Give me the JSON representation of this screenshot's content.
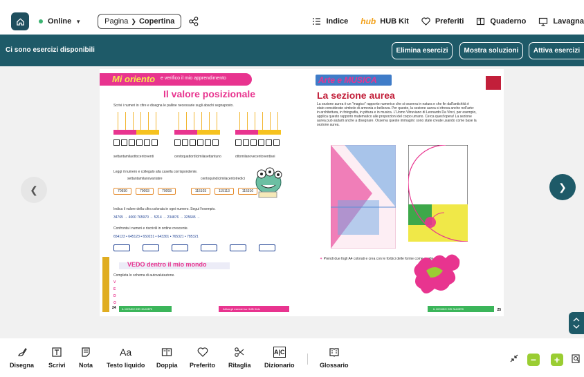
{
  "topbar": {
    "status_label": "Online",
    "breadcrumb": {
      "section": "Pagina",
      "page": "Copertina"
    },
    "nav": [
      {
        "label": "Indice",
        "icon": "list-icon"
      },
      {
        "label": "HUB Kit",
        "icon": "hub-kit-logo",
        "logo_text": "hub"
      },
      {
        "label": "Preferiti",
        "icon": "heart-icon"
      },
      {
        "label": "Quaderno",
        "icon": "notebook-icon"
      },
      {
        "label": "Lavagna",
        "icon": "whiteboard-icon"
      }
    ]
  },
  "band": {
    "title": "Ci sono esercizi disponibili",
    "buttons": [
      "Elimina esercizi",
      "Mostra soluzioni",
      "Attiva esercizi"
    ]
  },
  "reader": {
    "left_page": {
      "header": "Mi oriento",
      "header_sub": "e verifico il mio apprendimento",
      "title": "Il valore posizionale",
      "ex1": "Scrivi i numeri in cifre e disegna le palline necessarie sugli abachi segnaposto.",
      "abaco_labels": [
        "settantamilaottocentoventi",
        "centoquattordicimilasettantuno",
        "ottomilanovecentoventisei"
      ],
      "ex2": "Leggi il numero e collegalo alla casella corrispondente.",
      "ex2_words": [
        "settantamilanovantatre",
        "centoquindicimilacentotredici"
      ],
      "ex2_numbers": [
        "70930",
        "79093",
        "70093",
        "115103",
        "115113",
        "115310"
      ],
      "ex3": "Indica il valore della cifra colorata in ogni numero. Segui l'esempio.",
      "ex3_line": "34765 → 4000   765970 →        5214 →        234876 →        325645 →",
      "ex4": "Confronta i numeri e riscrivili in ordine crescente.",
      "ex4_line": "654123 • 645123 • 650231 • 643301 • 765321 • 785321",
      "vedo_title": "VEDO dentro il mio mondo",
      "vedo_sub": "Completa lo schema di autovalutazione.",
      "vedo_letters": [
        "V",
        "E",
        "D",
        "O"
      ],
      "footer_left": "IL MONDO DEI NUMERI",
      "footer_right": "Attiva gli esercizi su HUB Kids",
      "page_number": "24"
    },
    "right_page": {
      "header": "Arte e MUSICA",
      "title": "La sezione aurea",
      "text": "La sezione aurea è un \"magico\" rapporto numerico che si osserva in natura e che fin dall'antichità è stato considerato simbolo di armonia e bellezza. Per questo, la sezione aurea si ritrova anche nell'arte: in architettura, in fotografia, in pittura e in musica. L'Uomo Vitruviano di Leonardo Da Vinci, per esempio, applica questo rapporto matematico alle proporzioni del corpo umano. Cerca quest'opera! La sezione aurea può aiutarti anche a disegnare. Osserva queste immagini: sono state create usando come base la sezione aurea.",
      "note": "Prendi due fogli A4 colorati e crea con le forbici delle forme come quelle a lato.",
      "footer": "IL MONDO DEI NUMERI",
      "page_number": "25"
    }
  },
  "tools": [
    {
      "label": "Disegna",
      "icon": "pen-icon"
    },
    {
      "label": "Scrivi",
      "icon": "text-box-icon"
    },
    {
      "label": "Nota",
      "icon": "note-icon"
    },
    {
      "label": "Testo liquido",
      "icon": "font-icon",
      "glyph": "Aa"
    },
    {
      "label": "Doppia",
      "icon": "double-page-icon"
    },
    {
      "label": "Preferito",
      "icon": "heart-icon"
    },
    {
      "label": "Ritaglia",
      "icon": "scissors-icon"
    },
    {
      "label": "Dizionario",
      "icon": "dictionary-icon",
      "glyph": "A|C"
    },
    {
      "label": "Glossario",
      "icon": "glossary-icon"
    }
  ],
  "colors": {
    "teal": "#1e5a68",
    "green": "#9acd32",
    "pink": "#e8348f"
  }
}
